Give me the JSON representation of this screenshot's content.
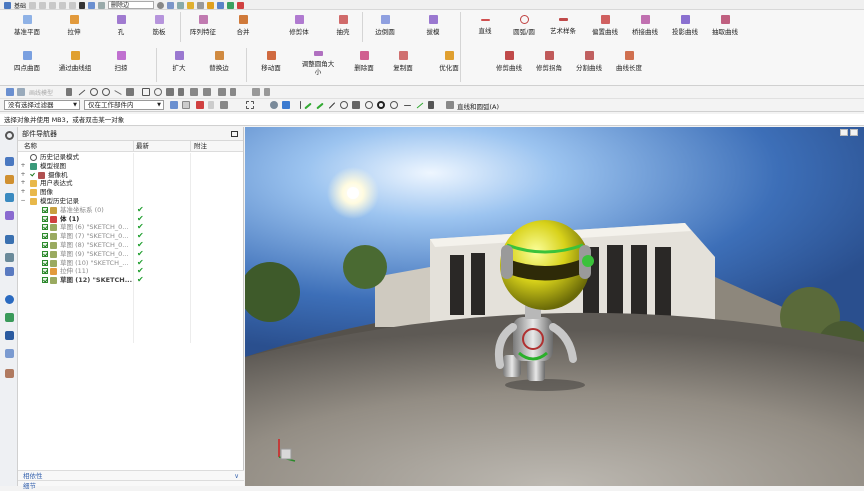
{
  "top": {
    "search_value": "删除边",
    "menu_label": "基础"
  },
  "ribbon": {
    "row1": [
      "基准平面",
      "拉伸",
      "孔",
      "筋板",
      "阵列特征",
      "合并",
      "修剪体",
      "抽壳",
      "边倒圆",
      "拔模",
      "直线",
      "圆弧/圆",
      "艺术样条",
      "偏置曲线",
      "桥接曲线",
      "投影曲线",
      "抽取曲线"
    ],
    "row2": [
      "四点曲面",
      "通过曲线组",
      "扫掠",
      "扩大",
      "替换边",
      "移动面",
      "调整圆角大小",
      "删除面",
      "复制面",
      "优化面",
      "修剪曲线",
      "修剪拐角",
      "分割曲线",
      "曲线长度"
    ]
  },
  "toolbar": {
    "snap_label": "画线模型",
    "filter_value": "没有选择过滤器",
    "scope_value": "仅在工作部件内",
    "curve_rule_label": "直线和圆弧(A)"
  },
  "status": {
    "text": "选择对象并使用 MB3，或者双击某一对象"
  },
  "nav": {
    "title": "部件导航器",
    "col_name": "名称",
    "col_latest": "最新",
    "col_note": "附注",
    "rows": [
      {
        "label": "历史记录模式",
        "level": 1
      },
      {
        "label": "模型视图",
        "level": 1
      },
      {
        "label": "摄像机",
        "level": 1
      },
      {
        "label": "用户表达式",
        "level": 1
      },
      {
        "label": "图像",
        "level": 1
      },
      {
        "label": "模型历史记录",
        "level": 1
      },
      {
        "label": "基准坐标系 (0)",
        "level": 2,
        "ok": "✔"
      },
      {
        "label": "体 (1)",
        "level": 2,
        "ok": "✔"
      },
      {
        "label": "草图 (6) \"SKETCH_0...",
        "level": 2,
        "ok": "✔"
      },
      {
        "label": "草图 (7) \"SKETCH_0...",
        "level": 2,
        "ok": "✔"
      },
      {
        "label": "草图 (8) \"SKETCH_0...",
        "level": 2,
        "ok": "✔"
      },
      {
        "label": "草图 (9) \"SKETCH_0...",
        "level": 2,
        "ok": "✔"
      },
      {
        "label": "草图 (10) \"SKETCH_...",
        "level": 2,
        "ok": "✔"
      },
      {
        "label": "拉伸 (11)",
        "level": 2,
        "ok": "✔"
      },
      {
        "label": "草图 (12) \"SKETCH...",
        "level": 2,
        "ok": "✔"
      }
    ],
    "bottom": [
      "相依性",
      "细节"
    ]
  },
  "colors": {
    "accent": "#2a62b8",
    "ok": "#1f9e2e",
    "folder": "#e8b84a"
  }
}
